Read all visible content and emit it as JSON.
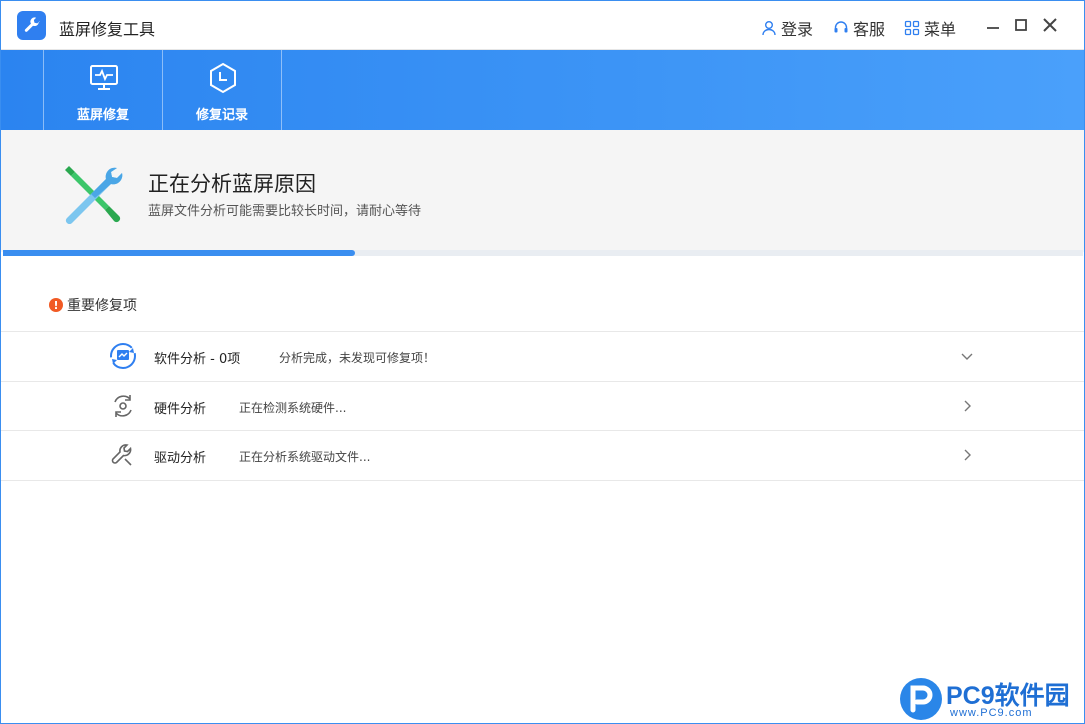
{
  "window": {
    "title": "蓝屏修复工具",
    "actions": [
      {
        "label": "登录",
        "icon": "user-icon"
      },
      {
        "label": "客服",
        "icon": "headset-icon"
      },
      {
        "label": "菜单",
        "icon": "menu-grid-icon"
      }
    ]
  },
  "nav": {
    "tabs": [
      {
        "label": "蓝屏修复",
        "icon": "monitor-pulse-icon"
      },
      {
        "label": "修复记录",
        "icon": "history-clock-icon"
      }
    ]
  },
  "status": {
    "title": "正在分析蓝屏原因",
    "subtitle": "蓝屏文件分析可能需要比较长时间，请耐心等待",
    "progress": 0.326,
    "accent_color": "#3a8ef0"
  },
  "section": {
    "title": "重要修复项",
    "warning_mark": "!",
    "items": [
      {
        "name": "软件分析 - 0项",
        "desc": "分析完成，未发现可修复项！",
        "icon": "software-analysis-icon",
        "chevron": "down"
      },
      {
        "name": "硬件分析",
        "desc": "正在检测系统硬件...",
        "icon": "hardware-analysis-icon",
        "chevron": "right"
      },
      {
        "name": "驱动分析",
        "desc": "正在分析系统驱动文件...",
        "icon": "driver-wrench-icon",
        "chevron": "right"
      }
    ]
  },
  "watermark": {
    "brand": "PC9软件园",
    "url": "www.PC9.com"
  }
}
